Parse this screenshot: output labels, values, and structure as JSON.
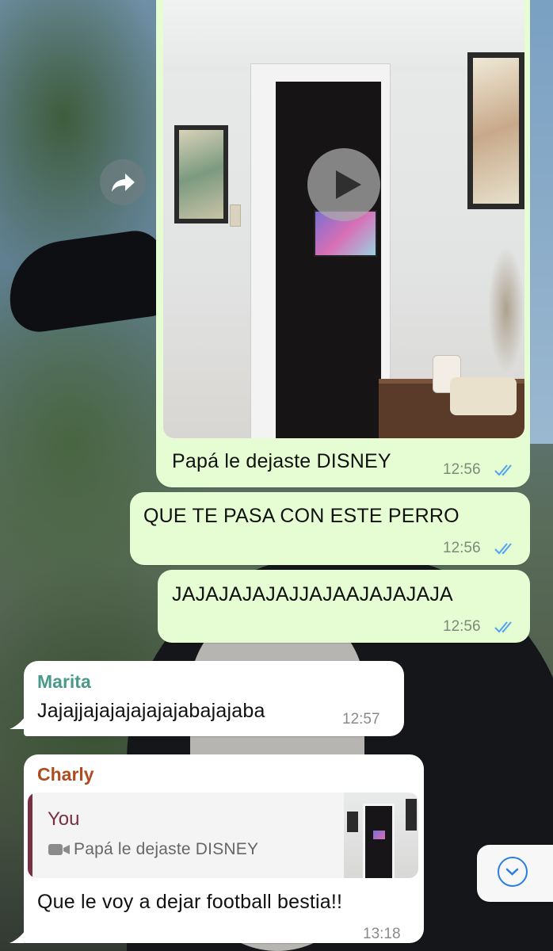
{
  "messages": [
    {
      "direction": "out",
      "type": "video",
      "caption": "Papá le dejaste DISNEY",
      "time": "12:56",
      "status": "read"
    },
    {
      "direction": "out",
      "type": "text",
      "text": "QUE TE PASA CON ESTE PERRO",
      "time": "12:56",
      "status": "read"
    },
    {
      "direction": "out",
      "type": "text",
      "text": "JAJAJAJAJAJJAJAAJAJAJAJA",
      "time": "12:56",
      "status": "read"
    },
    {
      "direction": "in",
      "sender": "Marita",
      "sender_color": "#4a9a8c",
      "type": "text",
      "text": "Jajajjajajajajajajabajajaba",
      "time": "12:57"
    },
    {
      "direction": "in",
      "sender": "Charly",
      "sender_color": "#b04a1f",
      "type": "reply",
      "reply": {
        "author": "You",
        "author_color": "#7a2f43",
        "media_icon": "video-camera-icon",
        "text": "Papá le dejaste DISNEY"
      },
      "text": "Que le voy a dejar football bestia!!",
      "time": "13:18"
    }
  ],
  "colors": {
    "outgoing_bubble": "#e6fdd4",
    "incoming_bubble": "#ffffff",
    "read_ticks": "#4fa3f0",
    "accent": "#2a7de1"
  },
  "icons": {
    "forward": "forward-arrow-icon",
    "play": "play-icon",
    "scroll_down": "chevron-down-circle-icon",
    "ticks": "double-check-icon"
  }
}
